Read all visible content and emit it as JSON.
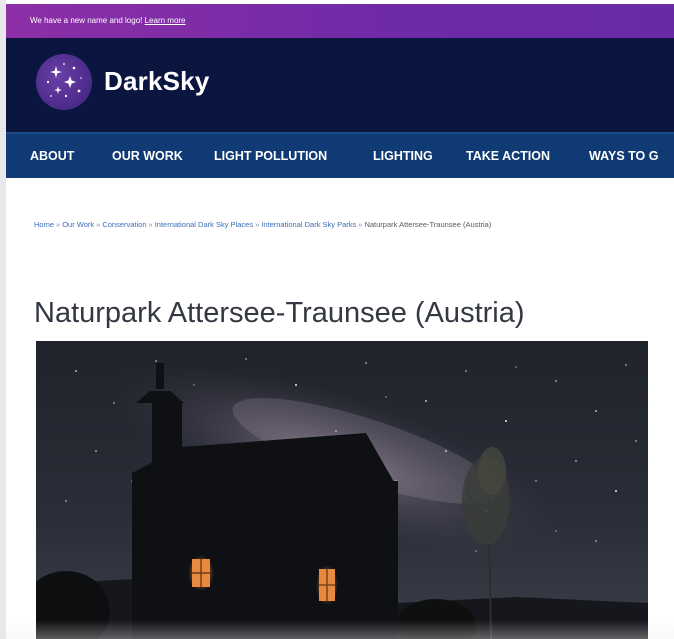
{
  "announcement": {
    "text": "We have a new name and logo! ",
    "link_label": "Learn more"
  },
  "header": {
    "brand_name": "DarkSky",
    "logo_icon": "starry-sky-logo-icon"
  },
  "nav": {
    "items": [
      {
        "label": "ABOUT"
      },
      {
        "label": "OUR WORK"
      },
      {
        "label": "LIGHT POLLUTION"
      },
      {
        "label": "LIGHTING"
      },
      {
        "label": "TAKE ACTION"
      },
      {
        "label": "WAYS TO G"
      }
    ]
  },
  "breadcrumb": {
    "items": [
      {
        "label": "Home"
      },
      {
        "label": "Our Work"
      },
      {
        "label": "Conservation"
      },
      {
        "label": "International Dark Sky Places"
      },
      {
        "label": "International Dark Sky Parks"
      }
    ],
    "separator": "»",
    "current": "Naturpark Attersee-Traunsee (Austria)"
  },
  "page": {
    "title": "Naturpark Attersee-Traunsee (Austria)"
  },
  "colors": {
    "announcement_bg": "#7d2da8",
    "header_bg": "#0b1640",
    "nav_bg": "#0f3a74",
    "link": "#3a6fb5",
    "title": "#333842"
  }
}
